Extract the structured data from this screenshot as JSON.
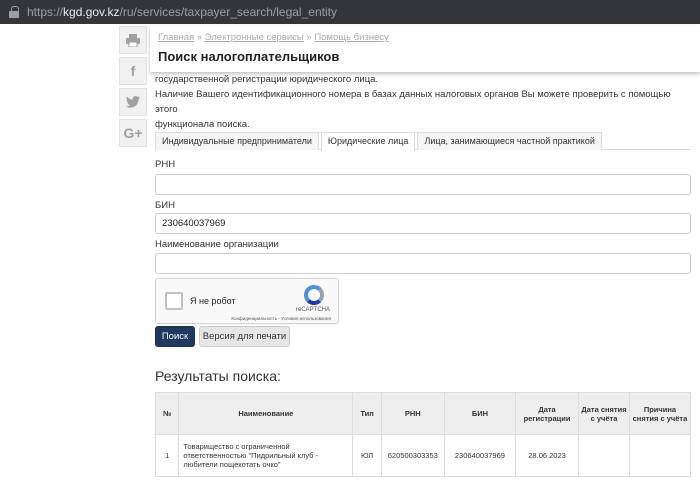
{
  "browser": {
    "url_prefix": "https://",
    "url_host": "kgd.gov.kz",
    "url_path": "/ru/services/taxpayer_search/legal_entity"
  },
  "share": [
    "print-icon",
    "facebook-icon",
    "twitter-icon",
    "google-plus-icon"
  ],
  "header": {
    "breadcrumb": [
      "Главная",
      "Электронные сервисы",
      "Помощь бизнесу"
    ],
    "title": "Поиск налогоплательщиков"
  },
  "intro": {
    "line1": "государственной регистрации юридического лица.",
    "line2": "Наличие Вашего идентификационного номера в базах данных налоговых органов Вы можете проверить с помощью этого",
    "line3": "функционала поиска."
  },
  "tabs": [
    "Индивидуальные предприниматели",
    "Юридические лица",
    "Лица, занимающиеся частной практикой"
  ],
  "form": {
    "rnn_label": "РНН",
    "rnn_value": "",
    "bin_label": "БИН",
    "bin_value": "230640037969",
    "name_label": "Наименование организации",
    "name_value": ""
  },
  "captcha": {
    "label": "Я не робот",
    "brand": "reCAPTCHA",
    "terms": "Конфиденциальность - Условия использования"
  },
  "buttons": {
    "search": "Поиск",
    "print": "Версия для печати"
  },
  "results": {
    "title": "Результаты поиска:",
    "headers": [
      "№",
      "Наименование",
      "Тип",
      "РНН",
      "БИН",
      "Дата регистрации",
      "Дата снятия с учёта",
      "Причина снятия с учёта"
    ],
    "rows": [
      [
        "1",
        "Товарищество с ограниченной ответственностью \"Пидрильный клуб - любители пощекотать очко\"",
        "ЮЛ",
        "620500303353",
        "230640037969",
        "28.06.2023",
        "",
        ""
      ]
    ]
  }
}
